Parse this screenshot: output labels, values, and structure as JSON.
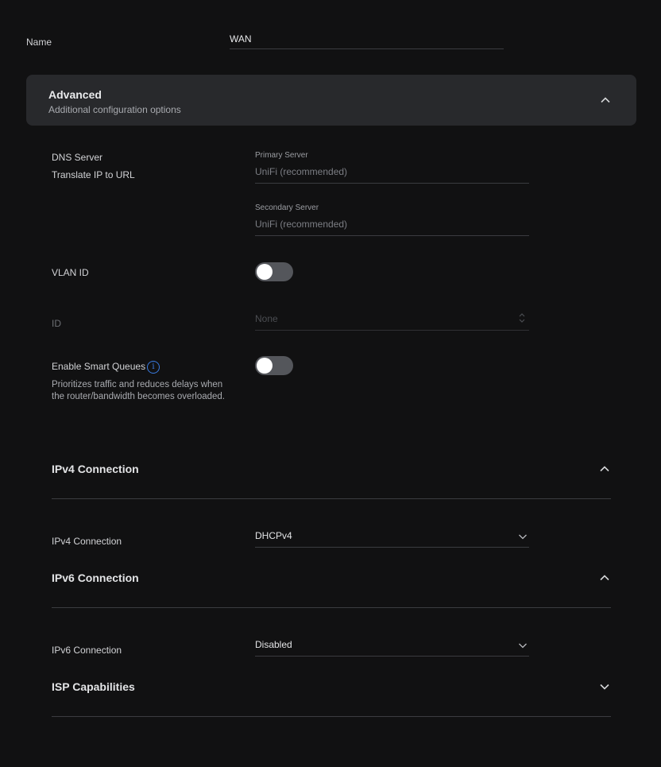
{
  "name_field": {
    "label": "Name",
    "value": "WAN"
  },
  "advanced": {
    "title": "Advanced",
    "subtitle": "Additional configuration options",
    "expanded": true
  },
  "dns": {
    "label": "DNS Server",
    "sublabel": "Translate IP to URL",
    "primary_label": "Primary Server",
    "primary_placeholder": "UniFi (recommended)",
    "secondary_label": "Secondary Server",
    "secondary_placeholder": "UniFi (recommended)"
  },
  "vlan": {
    "label": "VLAN ID",
    "enabled": false
  },
  "id_field": {
    "label": "ID",
    "placeholder": "None"
  },
  "smart_queues": {
    "label": "Enable Smart Queues",
    "description": "Prioritizes traffic and reduces delays when the router/bandwidth becomes overloaded.",
    "enabled": false
  },
  "ipv4": {
    "section_title": "IPv4 Connection",
    "label": "IPv4 Connection",
    "value": "DHCPv4"
  },
  "ipv6": {
    "section_title": "IPv6 Connection",
    "label": "IPv6 Connection",
    "value": "Disabled"
  },
  "isp": {
    "section_title": "ISP Capabilities"
  },
  "colors": {
    "background": "#111112",
    "panel": "#28292c",
    "accent": "#3a7be0",
    "toggle_off": "#54565b"
  }
}
